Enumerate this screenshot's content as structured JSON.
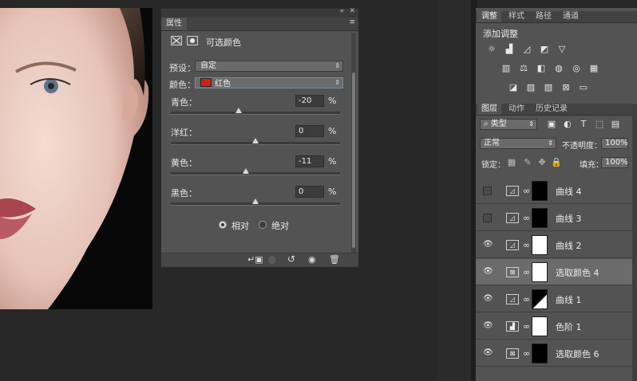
{
  "properties_panel": {
    "tab": "属性",
    "title": "可选颜色",
    "preset_label": "预设：",
    "preset_value": "自定",
    "colors_label": "颜色：",
    "colors_value": "红色",
    "colors_swatch": "#c8250f",
    "sliders": [
      {
        "label": "青色：",
        "value": "-20",
        "unit": "%",
        "level": -20
      },
      {
        "label": "洋红：",
        "value": "0",
        "unit": "%",
        "level": 0
      },
      {
        "label": "黄色：",
        "value": "-11",
        "unit": "%",
        "level": -11
      },
      {
        "label": "黑色：",
        "value": "0",
        "unit": "%",
        "level": 0
      }
    ],
    "method_relative": "相对",
    "method_absolute": "绝对",
    "selected_method": "相对"
  },
  "right_panel": {
    "top_tabs": [
      "调整",
      "样式",
      "路径",
      "通道"
    ],
    "active_top_tab": "调整",
    "add_adjustment_label": "添加调整",
    "adjust_icons_row1": [
      "brightness-icon",
      "levels-icon",
      "curves-icon",
      "exposure-icon",
      "vibrance-icon"
    ],
    "adjust_icons_row2": [
      "hue-icon",
      "balance-icon",
      "bw-icon",
      "photo-filter-icon",
      "channel-mixer-icon",
      "color-lookup-icon"
    ],
    "adjust_icons_row3": [
      "invert-icon",
      "posterize-icon",
      "threshold-icon",
      "selective-color-icon",
      "gradient-map-icon"
    ],
    "layer_tabs": [
      "图层",
      "动作",
      "历史记录"
    ],
    "active_layer_tab": "图层",
    "filter_kind": "类型",
    "blend_mode": "正常",
    "opacity_label": "不透明度：",
    "opacity_value": "100%",
    "lock_label": "锁定：",
    "fill_label": "填充：",
    "fill_value": "100%",
    "layers": [
      {
        "name": "曲线 4",
        "type": "curves",
        "visible": false,
        "selected": false
      },
      {
        "name": "曲线 3",
        "type": "curves",
        "visible": false,
        "selected": false
      },
      {
        "name": "曲线 2",
        "type": "curves",
        "visible": true,
        "selected": false
      },
      {
        "name": "选取颜色 4",
        "type": "selective-color",
        "visible": true,
        "selected": true
      },
      {
        "name": "曲线 1",
        "type": "curves",
        "visible": true,
        "selected": false
      },
      {
        "name": "色阶 1",
        "type": "levels",
        "visible": true,
        "selected": false
      },
      {
        "name": "选取颜色 6",
        "type": "selective-color",
        "visible": true,
        "selected": false
      }
    ]
  }
}
